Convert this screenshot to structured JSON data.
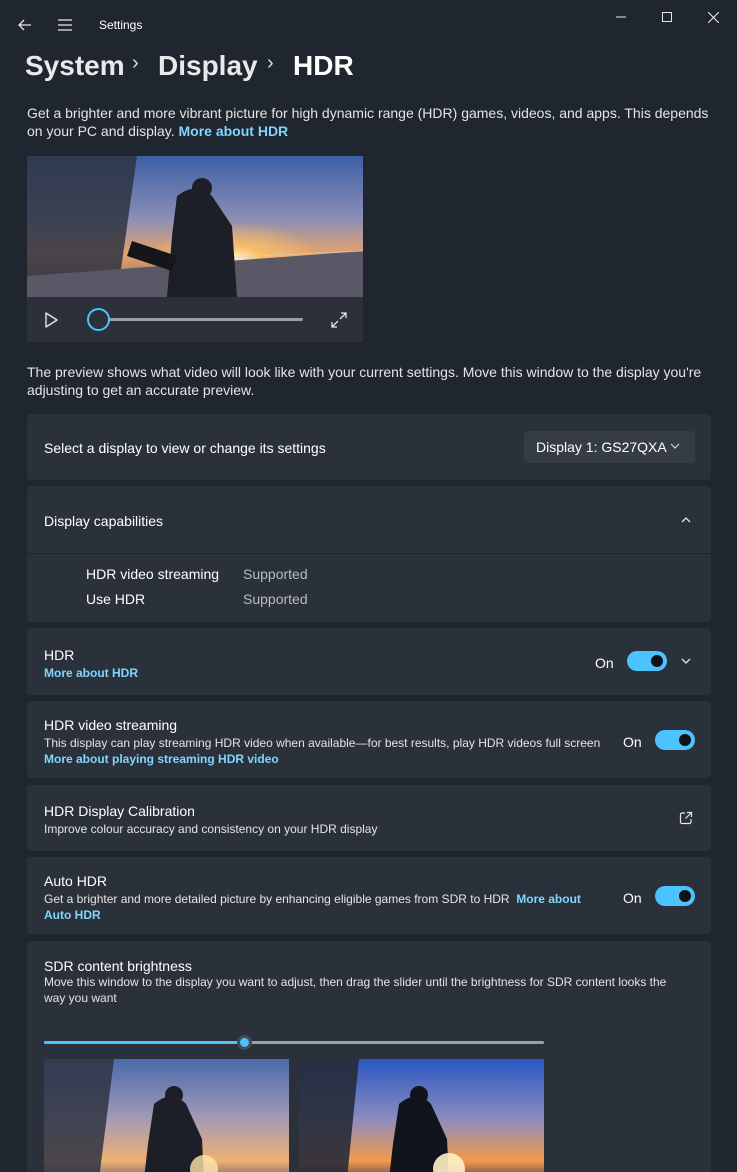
{
  "window": {
    "title": "Settings",
    "back_icon": "back-arrow-icon",
    "menu_icon": "hamburger-menu-icon"
  },
  "breadcrumb": {
    "items": [
      "System",
      "Display",
      "HDR"
    ],
    "separator": "›"
  },
  "intro": {
    "text": "Get a brighter and more vibrant picture for high dynamic range (HDR) games, videos, and apps. This depends on your PC and display.",
    "link": "More about HDR"
  },
  "video_preview": {
    "play_icon": "play-icon",
    "fullscreen_icon": "fullscreen-icon",
    "progress": 0
  },
  "preview_note": "The preview shows what video will look like with your current settings. Move this window to the display you're adjusting to get an accurate preview.",
  "display_select": {
    "label": "Select a display to view or change its settings",
    "value": "Display 1: GS27QXA"
  },
  "capabilities": {
    "title": "Display capabilities",
    "rows": [
      {
        "label": "HDR video streaming",
        "value": "Supported"
      },
      {
        "label": "Use HDR",
        "value": "Supported"
      }
    ]
  },
  "hdr": {
    "title": "HDR",
    "link": "More about HDR",
    "state": "On"
  },
  "hdr_streaming": {
    "title": "HDR video streaming",
    "desc": "This display can play streaming HDR video when available—for best results, play HDR videos full screen",
    "link": "More about playing streaming HDR video",
    "state": "On"
  },
  "calibration": {
    "title": "HDR Display Calibration",
    "desc": "Improve colour accuracy and consistency on your HDR display"
  },
  "auto_hdr": {
    "title": "Auto HDR",
    "desc": "Get a brighter and more detailed picture by enhancing eligible games from SDR to HDR",
    "link_a": "More about",
    "link_b": "Auto HDR",
    "state": "On"
  },
  "sdr": {
    "title": "SDR content brightness",
    "desc_1": "Move this window to the display you want to adjust, then drag the slider until the brightness for SDR content looks the",
    "desc_2": "way you want",
    "slider_value": 0.4
  },
  "colors": {
    "accent": "#4cc2ff",
    "link": "#7fd6ff",
    "background": "#202630",
    "card": "#2b313b"
  }
}
